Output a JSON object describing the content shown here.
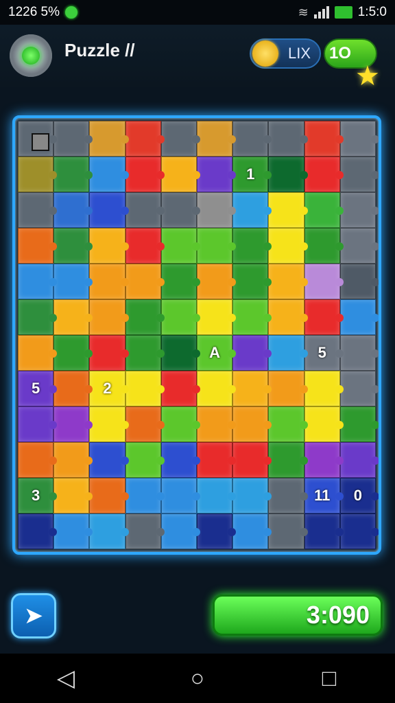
{
  "status_bar": {
    "time_left": "1226 5%",
    "time_right": "1:5:0"
  },
  "header": {
    "title": "Puzzle //",
    "coin_label": "LIX",
    "level_label": "1O"
  },
  "board": {
    "labels": [
      {
        "row": 1,
        "col": 6,
        "text": "1"
      },
      {
        "row": 6,
        "col": 5,
        "text": "A"
      },
      {
        "row": 6,
        "col": 8,
        "text": "5"
      },
      {
        "row": 7,
        "col": 0,
        "text": "5"
      },
      {
        "row": 7,
        "col": 2,
        "text": "2"
      },
      {
        "row": 10,
        "col": 0,
        "text": "3"
      },
      {
        "row": 10,
        "col": 8,
        "text": "11"
      },
      {
        "row": 10,
        "col": 9,
        "text": "0"
      }
    ],
    "colors": [
      [
        "#5d6873",
        "#5d6873",
        "#d79a2e",
        "#e23a2a",
        "#5d6873",
        "#d79a2e",
        "#5d6873",
        "#5d6873",
        "#e23a2a",
        "#6b7480"
      ],
      [
        "#9e8f2a",
        "#2e8f3d",
        "#2f8ee0",
        "#e82b2b",
        "#f6b21a",
        "#6a3ac9",
        "#2e9a2e",
        "#0d6a2e",
        "#e82b2b",
        "#5d6873"
      ],
      [
        "#5d6873",
        "#2f6fd0",
        "#2d4fd0",
        "#5d6873",
        "#5d6873",
        "#8f8f8f",
        "#2e9fe0",
        "#f6e31a",
        "#3ab33a",
        "#6b7480"
      ],
      [
        "#e86b1a",
        "#2e8f3d",
        "#f6b21a",
        "#e82b2b",
        "#5cc72c",
        "#5cc72c",
        "#2e9a2e",
        "#f6e31a",
        "#2e9a2e",
        "#6b7480"
      ],
      [
        "#2f8ee0",
        "#2f8ee0",
        "#f29b1a",
        "#f29b1a",
        "#2e9a2e",
        "#f29b1a",
        "#2e9a2e",
        "#f6b21a",
        "#b98ad9",
        "#4f5a66"
      ],
      [
        "#2e8f3d",
        "#f6b21a",
        "#f29b1a",
        "#2e9a2e",
        "#5cc72c",
        "#f6e31a",
        "#5cc72c",
        "#f6b21a",
        "#e82b2b",
        "#2f8ee0"
      ],
      [
        "#f29b1a",
        "#2e9a2e",
        "#e82b2b",
        "#2e9a2e",
        "#0d6a2e",
        "#5cc72c",
        "#6a3ac9",
        "#2e9fe0",
        "#6b7480",
        "#6b7480"
      ],
      [
        "#6a3ac9",
        "#e86b1a",
        "#f6e31a",
        "#f6e31a",
        "#e82b2b",
        "#f6e31a",
        "#f6b21a",
        "#f29b1a",
        "#f6e31a",
        "#6b7480"
      ],
      [
        "#6a3ac9",
        "#8e3ac9",
        "#f6e31a",
        "#e86b1a",
        "#5cc72c",
        "#f29b1a",
        "#f29b1a",
        "#5cc72c",
        "#f6e31a",
        "#2e9a2e"
      ],
      [
        "#e86b1a",
        "#f29b1a",
        "#2d4fd0",
        "#5cc72c",
        "#2d4fd0",
        "#e82b2b",
        "#e82b2b",
        "#2e9a2e",
        "#8e3ac9",
        "#6a3ac9"
      ],
      [
        "#2e8f3d",
        "#f6b21a",
        "#e86b1a",
        "#2f8ee0",
        "#2f8ee0",
        "#2e9fe0",
        "#2e9fe0",
        "#5d6873",
        "#2d4fd0",
        "#1a2e8f"
      ],
      [
        "#1a2e8f",
        "#2f8ee0",
        "#2e9fe0",
        "#5d6873",
        "#2f8ee0",
        "#1a2e8f",
        "#2f8ee0",
        "#5d6873",
        "#1a2e8f",
        "#1a2e8f"
      ]
    ]
  },
  "score": "3:090"
}
